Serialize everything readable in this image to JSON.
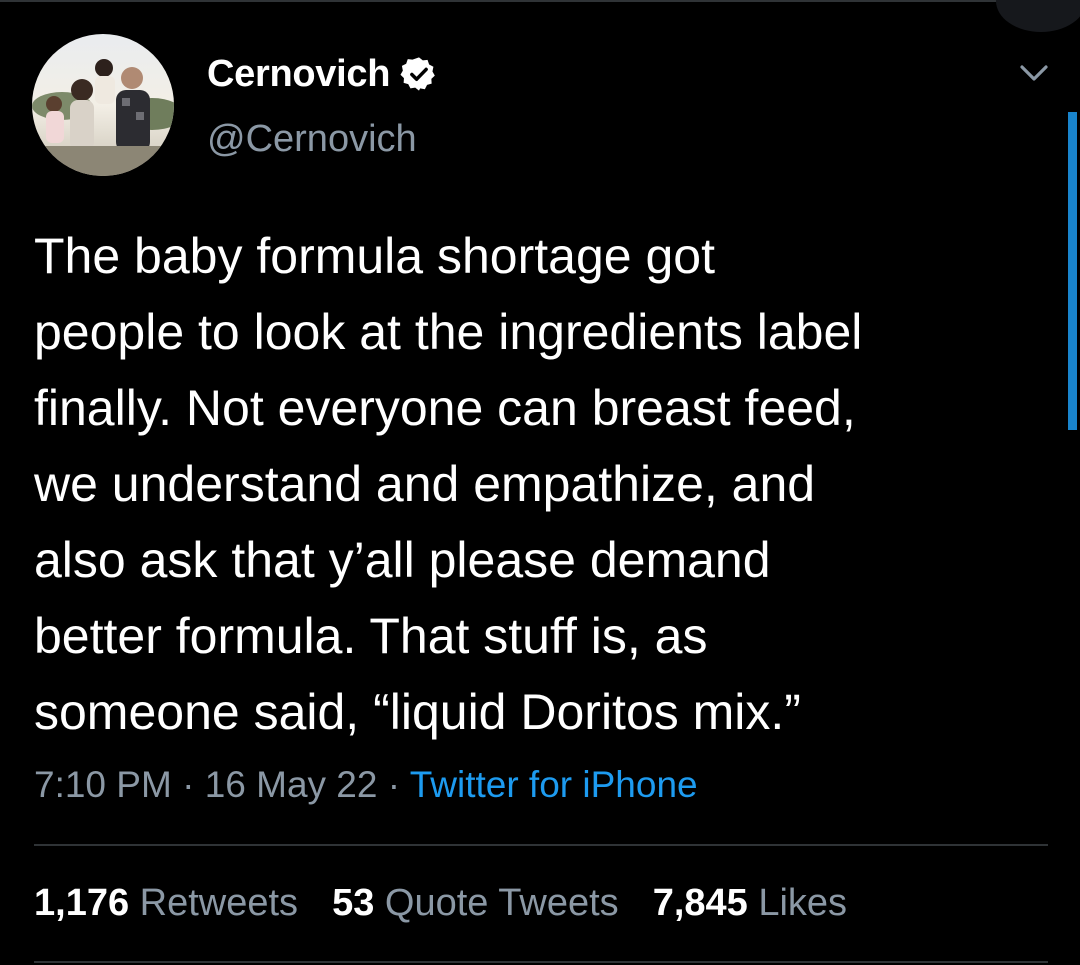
{
  "author": {
    "display_name": "Cernovich",
    "handle": "@Cernovich",
    "verified": true
  },
  "tweet": {
    "text": "The baby formula shortage got\npeople to look at the ingredients label\nfinally. Not everyone can breast feed,\nwe understand and empathize, and\nalso ask that y’all please demand\nbetter formula. That stuff is, as\nsomeone said, “liquid Doritos mix.”",
    "time": "7:10 PM",
    "separator": " · ",
    "date": "16 May 22",
    "source": "Twitter for iPhone"
  },
  "stats": {
    "retweets": {
      "count": "1,176",
      "label": "Retweets"
    },
    "quote_tweets": {
      "count": "53",
      "label": "Quote Tweets"
    },
    "likes": {
      "count": "7,845",
      "label": "Likes"
    }
  },
  "icons": {
    "verified": "verified-badge-icon",
    "more": "chevron-down-icon"
  },
  "colors": {
    "background": "#000000",
    "text": "#ffffff",
    "secondary": "#8b98a5",
    "accent": "#1d9bf0",
    "divider": "#2f3336"
  }
}
